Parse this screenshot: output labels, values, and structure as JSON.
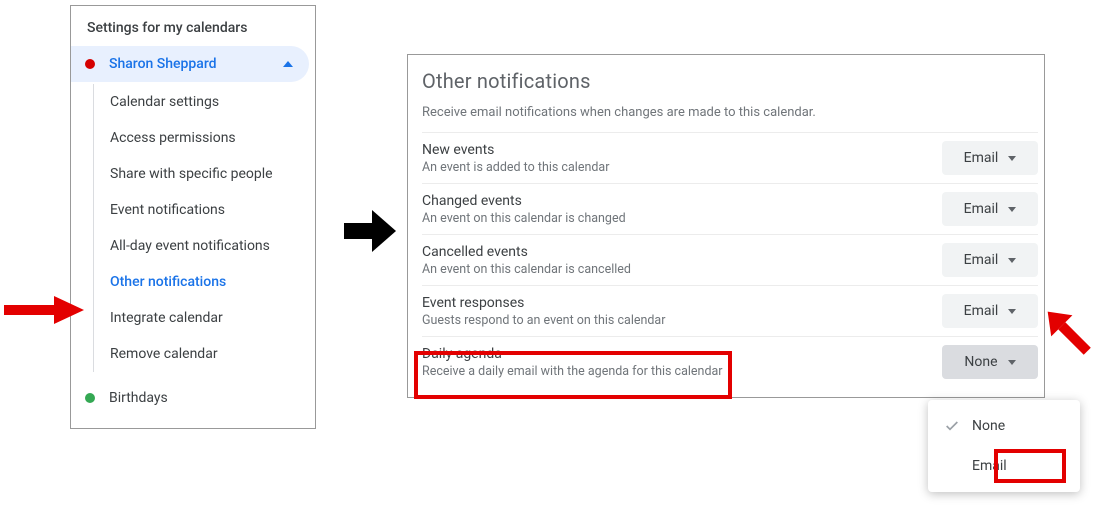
{
  "sidebar": {
    "heading": "Settings for my calendars",
    "calendar": {
      "name": "Sharon Sheppard",
      "color": "#d50000"
    },
    "items": [
      "Calendar settings",
      "Access permissions",
      "Share with specific people",
      "Event notifications",
      "All-day event notifications",
      "Other notifications",
      "Integrate calendar",
      "Remove calendar"
    ],
    "selected_index": 5,
    "other_calendar": {
      "name": "Birthdays",
      "color": "#34a853"
    }
  },
  "panel": {
    "title": "Other notifications",
    "description": "Receive email notifications when changes are made to this calendar.",
    "rows": [
      {
        "title": "New events",
        "sub": "An event is added to this calendar",
        "value": "Email"
      },
      {
        "title": "Changed events",
        "sub": "An event on this calendar is changed",
        "value": "Email"
      },
      {
        "title": "Cancelled events",
        "sub": "An event on this calendar is cancelled",
        "value": "Email"
      },
      {
        "title": "Event responses",
        "sub": "Guests respond to an event on this calendar",
        "value": "Email"
      },
      {
        "title": "Daily agenda",
        "sub": "Receive a daily email with the agenda for this calendar",
        "value": "None"
      }
    ]
  },
  "menu": {
    "items": [
      "None",
      "Email"
    ],
    "selected": "None"
  }
}
